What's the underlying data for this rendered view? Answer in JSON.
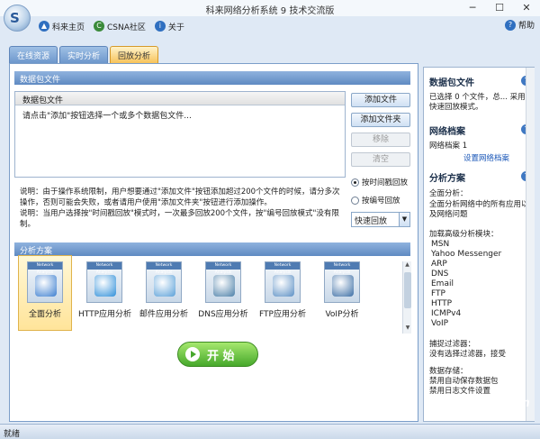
{
  "window": {
    "title": "科来网络分析系统 9 技术交流版",
    "min": "─",
    "max": "☐",
    "close": "✕"
  },
  "menu": [
    {
      "label": "科来主页",
      "icon": "colasoft-home-icon",
      "color": "#2f6fc0",
      "glyph": "▲"
    },
    {
      "label": "CSNA社区",
      "icon": "csna-community-icon",
      "color": "#3a8a3a",
      "glyph": "C"
    },
    {
      "label": "关于",
      "icon": "info-icon",
      "color": "#2f6fc0",
      "glyph": "i"
    }
  ],
  "help": {
    "label": "帮助",
    "glyph": "?"
  },
  "tabs": [
    {
      "label": "在线资源",
      "active": false
    },
    {
      "label": "实时分析",
      "active": false
    },
    {
      "label": "回放分析",
      "active": true
    }
  ],
  "files": {
    "section_title": "数据包文件",
    "column": "数据包文件",
    "hint": "请点击\"添加\"按钮选择一个或多个数据包文件...",
    "buttons": {
      "add_file": "添加文件",
      "add_folder": "添加文件夹",
      "remove": "移除",
      "clear": "清空"
    },
    "radio_time": "按时间戳回放",
    "radio_number": "按编号回放",
    "speed": "快速回放",
    "note1": "说明：由于操作系统限制，用户想要通过\"添加文件\"按钮添加超过200个文件的时候，请分多次操作，否则可能会失败，或者请用户使用\"添加文件夹\"按钮进行添加操作。",
    "note2": "说明：当用户选择按\"时间戳回放\"模式时，一次最多回放200个文件，按\"编号回放模式\"没有限制。"
  },
  "schemes": {
    "section_title": "分析方案",
    "band_text": "Network Analysis",
    "items": [
      {
        "label": "全面分析",
        "icon": "magnifier-icon",
        "color": "#3d7fd0",
        "selected": true
      },
      {
        "label": "HTTP应用分析",
        "icon": "globe-icon",
        "color": "#2f8fd9",
        "selected": false
      },
      {
        "label": "邮件应用分析",
        "icon": "mail-icon",
        "color": "#5aa0d8",
        "selected": false
      },
      {
        "label": "DNS应用分析",
        "icon": "dns-server-icon",
        "color": "#4b7fa8",
        "selected": false
      },
      {
        "label": "FTP应用分析",
        "icon": "ftp-network-icon",
        "color": "#5b8fc4",
        "selected": false
      },
      {
        "label": "VoIP分析",
        "icon": "headset-icon",
        "color": "#3c6ea5",
        "selected": false
      }
    ],
    "start": "开 始"
  },
  "right": {
    "files_title": "数据包文件",
    "files_text": "已选择 0 个文件，总... 采用快速回放模式。",
    "profile_title": "网络档案",
    "profile_text": "网络档案 1",
    "profile_link": "设置网络档案",
    "scheme_title": "分析方案",
    "scheme_text1": "全面分析：",
    "scheme_text2": "全面分析网络中的所有应用以及网络问题",
    "modules_title": "加载高级分析模块：",
    "modules": [
      "MSN",
      "Yahoo Messenger",
      "ARP",
      "DNS",
      "Email",
      "FTP",
      "HTTP",
      "ICMPv4",
      "VoIP"
    ],
    "filter_title": "捕捉过滤器：",
    "filter_text": "没有选择过滤器，接受",
    "storage_title": "数据存储：",
    "storage_text1": "禁用自动保存数据包",
    "storage_text2": "禁用日志文件设置"
  },
  "status": "就绪",
  "watermark": "X 510.com"
}
